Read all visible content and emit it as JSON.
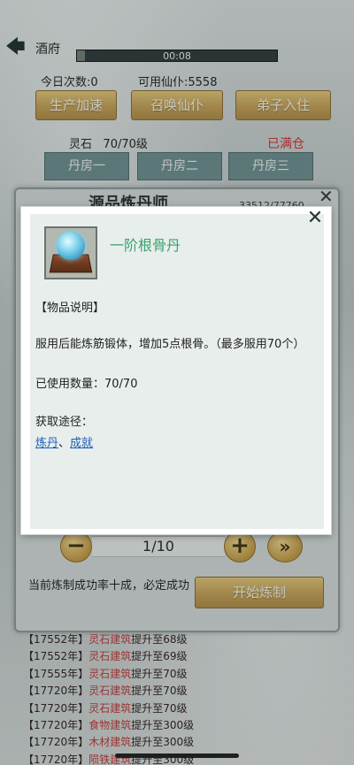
{
  "top_bar": {
    "back_icon": "back-arrow-icon",
    "title": "酒府",
    "timer": "00:08",
    "timer_progress": 0.04
  },
  "stats": {
    "today": "今日次数:0",
    "coin": "可用仙仆:5558"
  },
  "actions": {
    "speed": "生产加速",
    "summon": "召唤仙仆",
    "disciple": "弟子入住"
  },
  "spirit": {
    "label": "灵石",
    "level": "70/70级",
    "full": "已满仓"
  },
  "tabs": [
    "丹房一",
    "丹房二",
    "丹房三"
  ],
  "panel": {
    "title": "源品炼丹师",
    "exp": "33512/77760",
    "stepper_value": "1/10",
    "success_text": "当前炼制成功率十成，必定成功",
    "start_label": "开始炼制"
  },
  "log": [
    {
      "prefix": "【17552年】",
      "hl": "灵石建筑",
      "suffix": "提升至68级"
    },
    {
      "prefix": "【17552年】",
      "hl": "灵石建筑",
      "suffix": "提升至69级"
    },
    {
      "prefix": "【17555年】",
      "hl": "灵石建筑",
      "suffix": "提升至70级"
    },
    {
      "prefix": "【17720年】",
      "hl": "灵石建筑",
      "suffix": "提升至70级"
    },
    {
      "prefix": "【17720年】",
      "hl": "灵石建筑",
      "suffix": "提升至70级"
    },
    {
      "prefix": "【17720年】",
      "hl": "食物建筑",
      "suffix": "提升至300级"
    },
    {
      "prefix": "【17720年】",
      "hl": "木材建筑",
      "suffix": "提升至300级"
    },
    {
      "prefix": "【17720年】",
      "hl": "陨铁建筑",
      "suffix": "提升至300级"
    }
  ],
  "modal": {
    "item_name": "一阶根骨丹",
    "item_icon": "pill-orb-icon",
    "desc_header": "【物品说明】",
    "desc_body": "服用后能炼筋锻体，增加5点根骨。（最多服用70个）",
    "used_count": "已使用数量：70/70",
    "source_label": "获取途径：",
    "source_1": "炼丹",
    "source_sep": "、",
    "source_2": "成就"
  }
}
